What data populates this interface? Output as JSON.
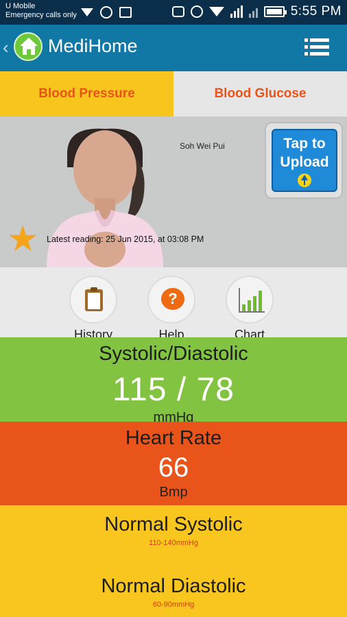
{
  "status_bar": {
    "carrier": "U Mobile",
    "carrier_sub": "Emergency calls only",
    "network_label": "2G",
    "time": "5:55 PM"
  },
  "app_bar": {
    "title": "MediHome"
  },
  "tabs": [
    {
      "label": "Blood Pressure",
      "active": true
    },
    {
      "label": "Blood Glucose",
      "active": false
    }
  ],
  "profile": {
    "name": "Soh Wei Pui",
    "latest_reading": "Latest reading:  25 Jun 2015, at 03:08 PM",
    "upload_label_1": "Tap to",
    "upload_label_2": "Upload"
  },
  "actions": [
    {
      "label": "History",
      "icon": "clipboard-icon"
    },
    {
      "label": "Help",
      "icon": "help-icon"
    },
    {
      "label": "Chart",
      "icon": "chart-icon"
    }
  ],
  "readings": {
    "systolic_diastolic": {
      "title": "Systolic/Diastolic",
      "value": "115 / 78",
      "unit": "mmHg"
    },
    "heart_rate": {
      "title": "Heart Rate",
      "value": "66",
      "unit": "Bmp"
    }
  },
  "normals": {
    "systolic": {
      "title": "Normal Systolic",
      "range": "110-140mmHg"
    },
    "diastolic": {
      "title": "Normal Diastolic",
      "range": "60-90mmHg"
    }
  },
  "colors": {
    "status_bar": "#0b2f4a",
    "app_bar": "#1178a6",
    "tab_active": "#f7c51e",
    "tab_text": "#e8541a",
    "systolic_card": "#82c341",
    "heart_rate_card": "#e8541a",
    "normals_card": "#f8c61f"
  }
}
